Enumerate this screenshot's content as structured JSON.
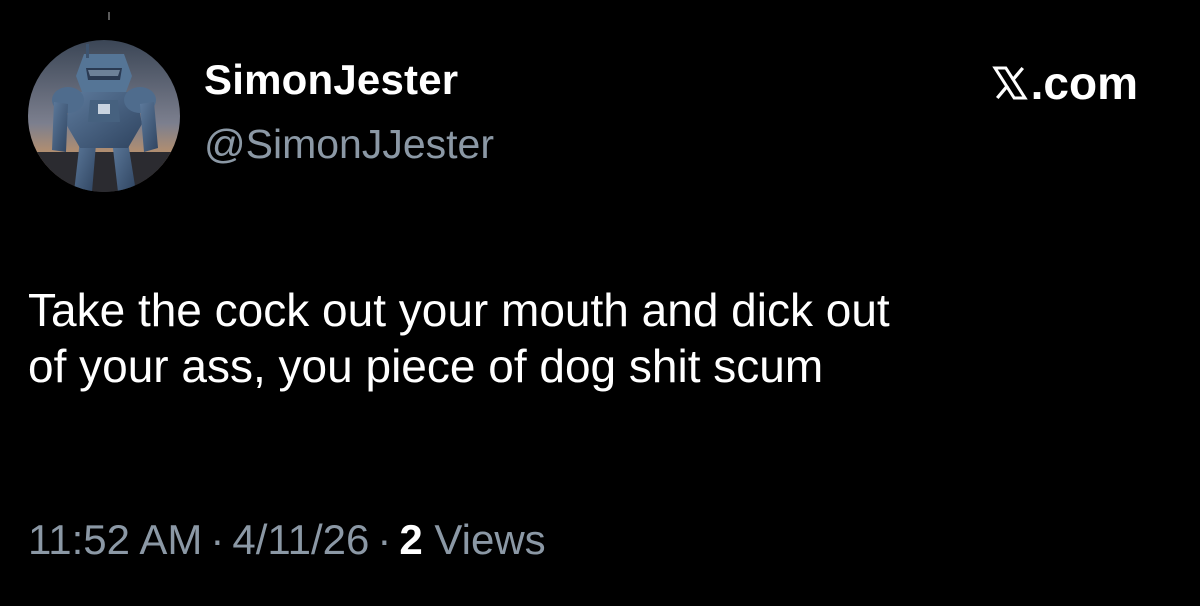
{
  "author": {
    "display_name": "SimonJester",
    "handle": "@SimonJJester",
    "avatar_icon": "armored-soldier-avatar"
  },
  "source": {
    "label": ".com",
    "logo_icon": "x-logo-icon"
  },
  "tweet": {
    "text_lines": [
      "Take the cock out your mouth and dick out",
      "of your ass, you piece of dog shit scum"
    ]
  },
  "meta": {
    "time": "11:52 AM",
    "separator": "·",
    "date": "4/11/26",
    "views_count": "2",
    "views_label": "Views"
  },
  "colors": {
    "background": "#000000",
    "primary_text": "#ffffff",
    "secondary_text": "#8b98a5"
  }
}
